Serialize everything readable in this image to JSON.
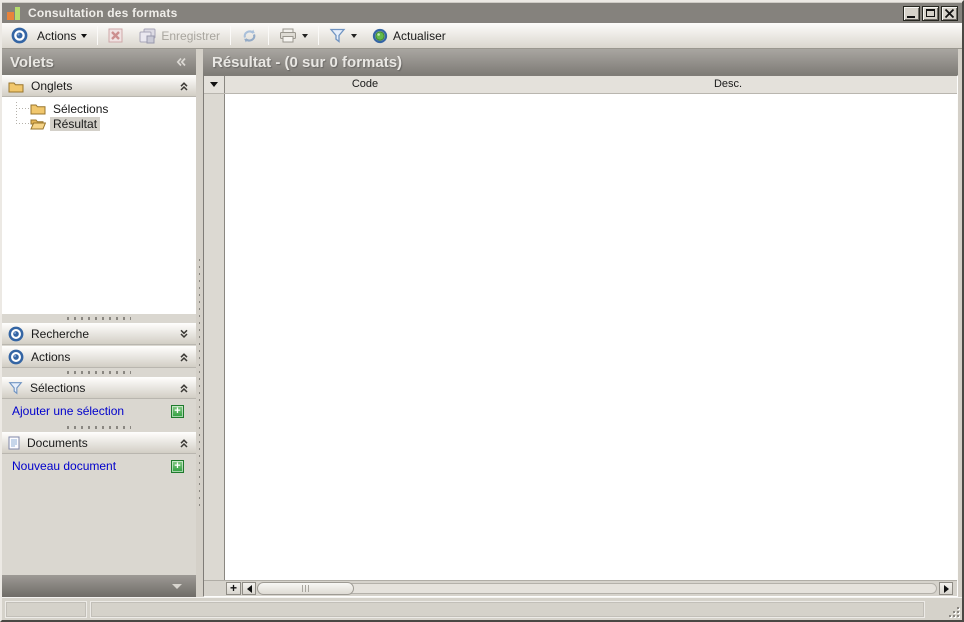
{
  "window": {
    "title": "Consultation des formats"
  },
  "toolbar": {
    "actions": {
      "label": "Actions"
    },
    "save": {
      "label": "Enregistrer",
      "enabled": false
    },
    "delete_enabled": false,
    "refresh_enabled": false,
    "actualiser": {
      "label": "Actualiser"
    }
  },
  "sidebar": {
    "caption": "Volets",
    "groups": {
      "onglets": {
        "label": "Onglets",
        "state": "expanded"
      },
      "recherche": {
        "label": "Recherche",
        "state": "collapsed"
      },
      "actions": {
        "label": "Actions",
        "state": "expanded"
      },
      "selections": {
        "label": "Sélections",
        "state": "expanded",
        "link": "Ajouter une sélection"
      },
      "documents": {
        "label": "Documents",
        "state": "expanded",
        "link": "Nouveau document"
      }
    },
    "tree": {
      "items": [
        {
          "label": "Sélections",
          "selected": false
        },
        {
          "label": "Résultat",
          "selected": true
        }
      ]
    }
  },
  "main": {
    "caption": "Résultat - (0 sur 0 formats)",
    "grid": {
      "columns": [
        {
          "label": "Code"
        },
        {
          "label": "Desc."
        }
      ],
      "rows": []
    }
  },
  "glyphs": {
    "plus": "+"
  },
  "colors": {
    "titlebar": "#85827d",
    "caption_bar_top": "#a9a6a1",
    "caption_bar_bottom": "#7e7b76",
    "caption_text": "#e9e7e3",
    "link": "#0000cc",
    "add_button_green": "#2f9e3f",
    "selected_tree_item_bg": "#d3d0c9",
    "window_chrome": "#d4d0c8",
    "target_icon_blue": "#3465a4",
    "actualiser_green": "#63b94c"
  }
}
